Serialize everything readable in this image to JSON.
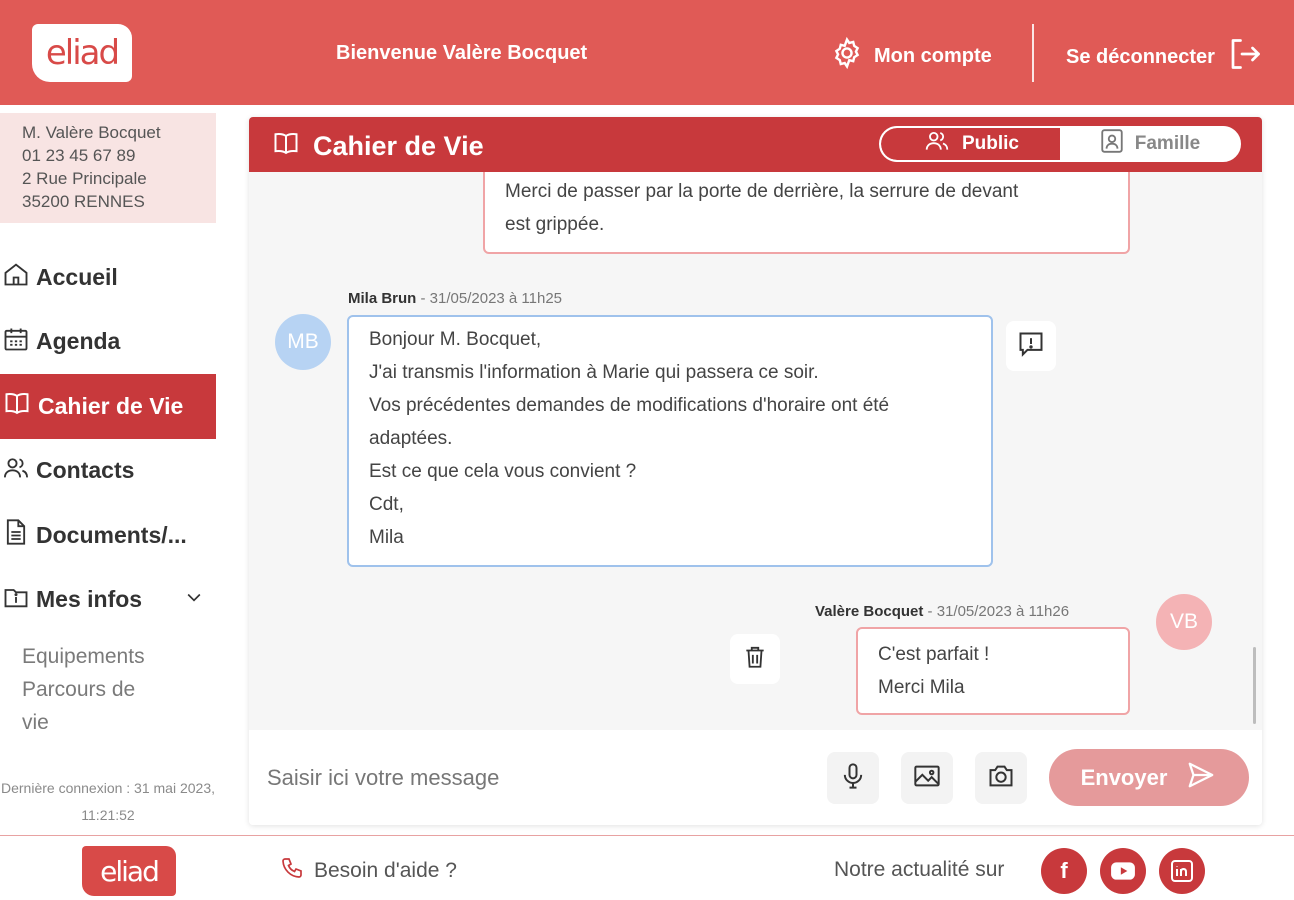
{
  "colors": {
    "brand": "#e05a56",
    "dark_red": "#c8393c",
    "outgoing_border": "#f0a4a6",
    "incoming_border": "#9fc2ec"
  },
  "header": {
    "logo": "eliad",
    "welcome": "Bienvenue Valère Bocquet",
    "account_label": "Mon compte",
    "account_icon": "gear-icon",
    "logout_label": "Se déconnecter",
    "logout_icon": "logout-icon"
  },
  "user": {
    "name": "M. Valère Bocquet",
    "phone": "01 23 45 67 89",
    "address": "2 Rue Principale",
    "city": "35200 RENNES"
  },
  "nav": {
    "items": [
      {
        "label": "Accueil",
        "icon": "home-icon"
      },
      {
        "label": "Agenda",
        "icon": "calendar-icon"
      },
      {
        "label": "Cahier de Vie",
        "icon": "book-icon",
        "active": true
      },
      {
        "label": "Contacts",
        "icon": "contacts-icon"
      },
      {
        "label": "Documents/...",
        "icon": "document-icon"
      },
      {
        "label": "Mes infos",
        "icon": "info-icon"
      }
    ],
    "sub_items": [
      "Equipements",
      "Parcours de vie"
    ],
    "last_connection": "Dernière connexion : 31 mai 2023, 11:21:52"
  },
  "panel": {
    "title": "Cahier de Vie",
    "toggle": {
      "public": "Public",
      "family": "Famille"
    }
  },
  "messages": {
    "prev_out": {
      "lines": [
        "Merci de passer par la porte de derrière, la serrure de devant",
        "est grippée."
      ]
    },
    "in_1": {
      "author": "Mila Brun",
      "date": " - 31/05/2023 à 11h25",
      "initials": "MB",
      "lines": [
        "Bonjour M. Bocquet,",
        "J'ai transmis l'information à Marie qui passera ce soir.",
        "Vos précédentes demandes de modifications d'horaire ont été",
        "adaptées.",
        "Est ce que cela vous convient ?",
        "Cdt,",
        "Mila"
      ]
    },
    "out_1": {
      "author": "Valère Bocquet",
      "date": " - 31/05/2023 à 11h26",
      "initials": "VB",
      "lines": [
        "C'est parfait !",
        "Merci Mila"
      ]
    }
  },
  "composer": {
    "placeholder": "Saisir ici votre message",
    "send_label": "Envoyer"
  },
  "footer": {
    "logo": "eliad",
    "help": "Besoin d'aide ?",
    "news": "Notre actualité sur",
    "socials": [
      "facebook",
      "youtube",
      "linkedin"
    ]
  }
}
